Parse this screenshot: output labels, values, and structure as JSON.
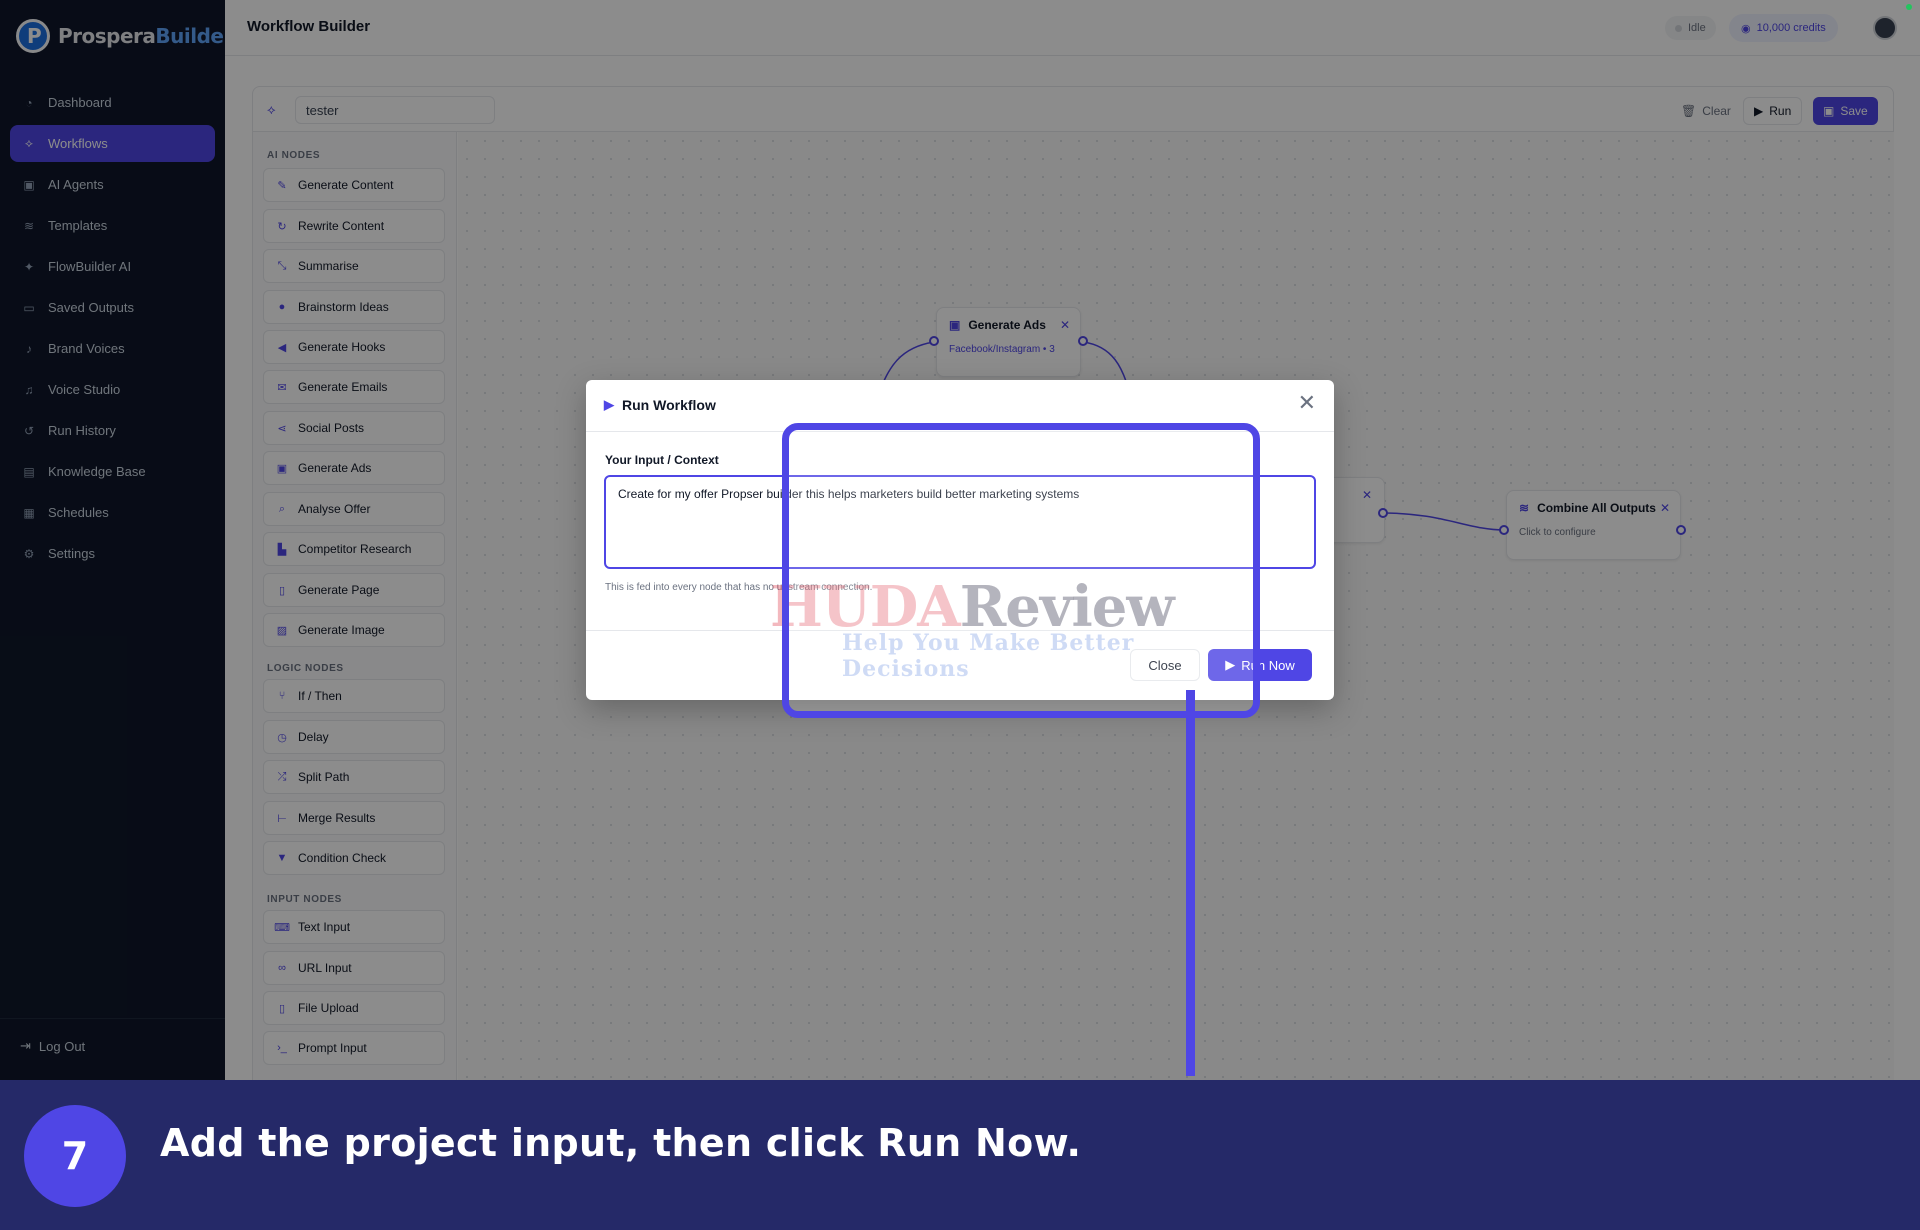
{
  "brand": {
    "name_part1": "Prospera",
    "name_part2": "Builder"
  },
  "sidebar": {
    "items": [
      {
        "label": "Dashboard",
        "icon": "dashboard-icon"
      },
      {
        "label": "Workflows",
        "icon": "workflow-icon",
        "active": true
      },
      {
        "label": "AI Agents",
        "icon": "robot-icon"
      },
      {
        "label": "Templates",
        "icon": "layers-icon"
      },
      {
        "label": "FlowBuilder AI",
        "icon": "magic-icon"
      },
      {
        "label": "Saved Outputs",
        "icon": "inbox-icon"
      },
      {
        "label": "Brand Voices",
        "icon": "microphone-icon"
      },
      {
        "label": "Voice Studio",
        "icon": "mic-icon"
      },
      {
        "label": "Run History",
        "icon": "history-icon"
      },
      {
        "label": "Knowledge Base",
        "icon": "book-icon"
      },
      {
        "label": "Schedules",
        "icon": "calendar-icon"
      },
      {
        "label": "Settings",
        "icon": "gear-icon"
      }
    ],
    "logout_label": "Log Out"
  },
  "header": {
    "title": "Workflow Builder",
    "status": "Idle",
    "credits": "10,000 credits"
  },
  "toolbar": {
    "workflow_name": "tester",
    "clear_label": "Clear",
    "run_label": "Run",
    "save_label": "Save"
  },
  "palette": {
    "ai_nodes_label": "AI NODES",
    "ai_nodes": [
      "Generate Content",
      "Rewrite Content",
      "Summarise",
      "Brainstorm Ideas",
      "Generate Hooks",
      "Generate Emails",
      "Social Posts",
      "Generate Ads",
      "Analyse Offer",
      "Competitor Research",
      "Generate Page",
      "Generate Image"
    ],
    "logic_nodes_label": "LOGIC NODES",
    "logic_nodes": [
      "If / Then",
      "Delay",
      "Split Path",
      "Merge Results",
      "Condition Check"
    ],
    "input_nodes_label": "INPUT NODES",
    "input_nodes": [
      "Text Input",
      "URL Input",
      "File Upload",
      "Prompt Input"
    ]
  },
  "canvas": {
    "nodes": [
      {
        "title": "Generate Ads",
        "subtitle": "Facebook/Instagram • 3"
      },
      {
        "title": "Combine All Outputs",
        "subtitle": "Click to configure"
      }
    ]
  },
  "modal": {
    "title": "Run Workflow",
    "field_label": "Your Input / Context",
    "input_value": "Create for my offer Propser builder this helps marketers build better marketing systems",
    "helper_text": "This is fed into every node that has no upstream connection.",
    "close_label": "Close",
    "run_now_label": "Run Now"
  },
  "watermark": {
    "main_a": "HUDA",
    "main_b": "Review",
    "sub": "Help You Make Better Decisions"
  },
  "caption": {
    "step": "7",
    "text": "Add the project input, then click Run Now."
  },
  "colors": {
    "accent": "#4f46e5",
    "sidebar_bg": "#0f172a",
    "banner_bg": "#252968"
  }
}
